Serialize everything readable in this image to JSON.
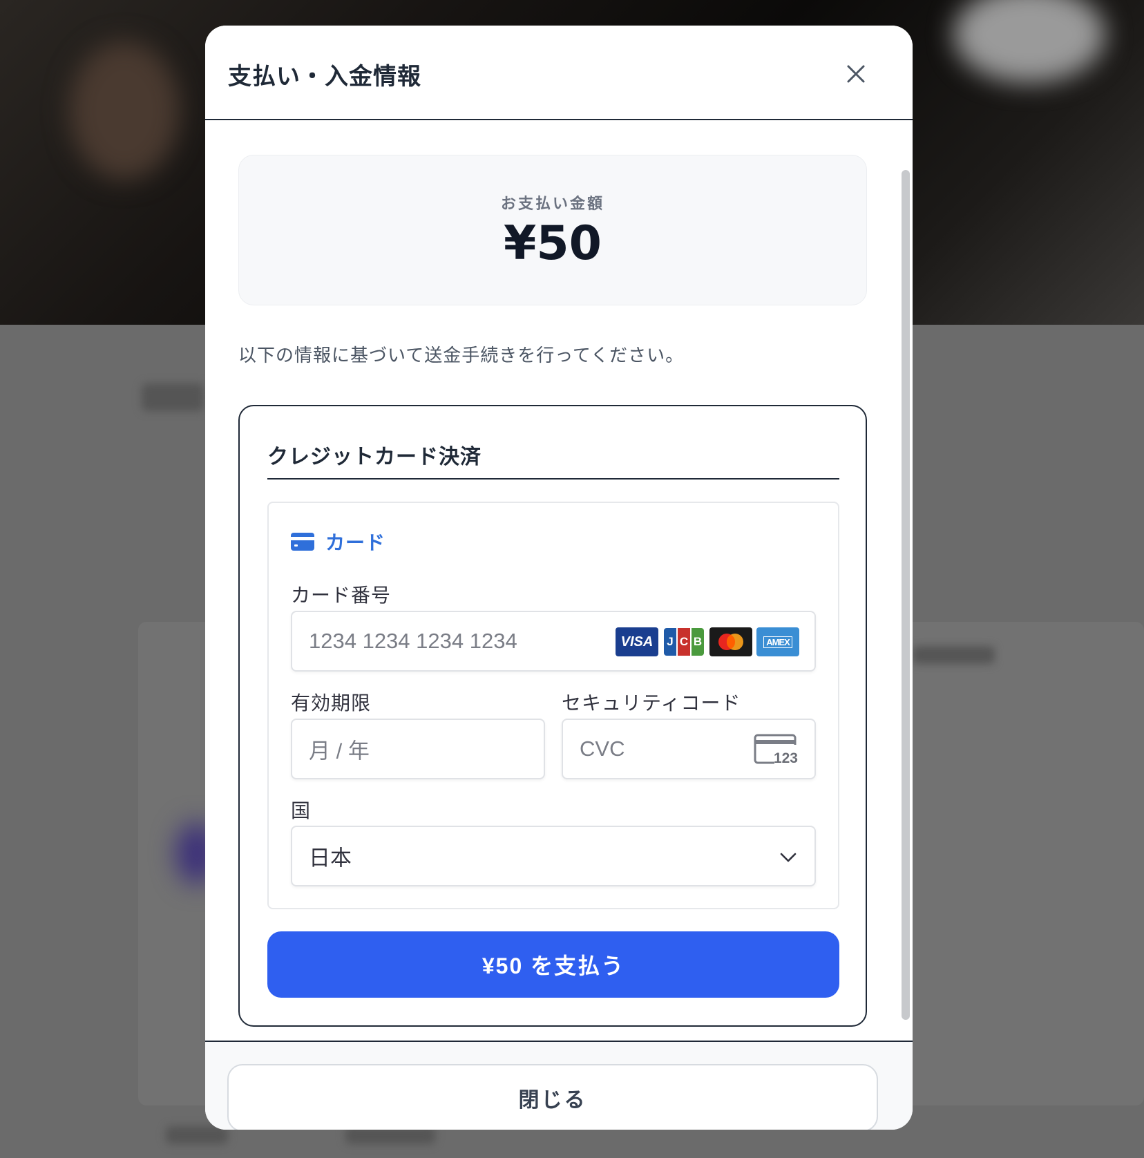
{
  "modal": {
    "title": "支払い・入金情報",
    "close_icon": "close-icon"
  },
  "amount": {
    "label": "お支払い金額",
    "value": "¥50"
  },
  "instruction": "以下の情報に基づいて送金手続きを行ってください。",
  "credit_card": {
    "section_title": "クレジットカード決済",
    "tab": {
      "icon": "credit-card-icon",
      "label": "カード"
    },
    "card_number": {
      "label": "カード番号",
      "placeholder": "1234 1234 1234 1234",
      "brands": [
        "VISA",
        "JCB",
        "Mastercard",
        "AMEX"
      ]
    },
    "expiry": {
      "label": "有効期限",
      "placeholder": "月 / 年"
    },
    "cvc": {
      "label": "セキュリティコード",
      "placeholder": "CVC",
      "icon_text": "123"
    },
    "country": {
      "label": "国",
      "value": "日本"
    },
    "pay_button": "¥50 を支払う"
  },
  "footer": {
    "close_button": "閉じる"
  },
  "colors": {
    "accent": "#2f5ff0",
    "tab_blue": "#2f6fda",
    "text_dark": "#1f2937"
  }
}
